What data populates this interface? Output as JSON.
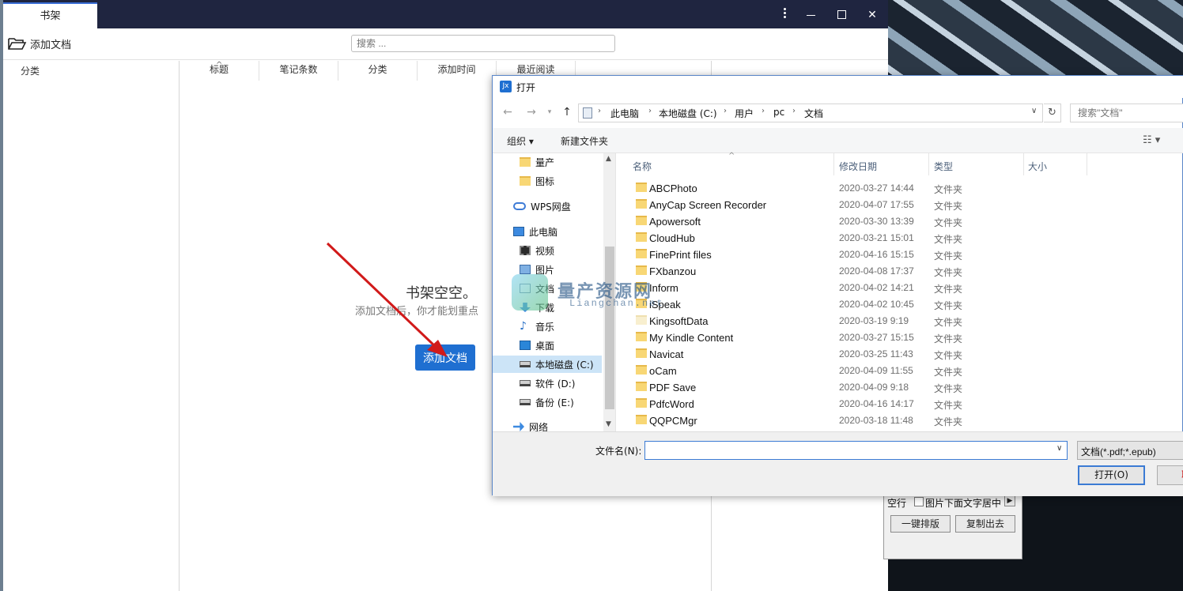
{
  "app": {
    "tab_label": "书架",
    "add_doc_label": "添加文档",
    "search_placeholder": "搜索 ...",
    "sidebar_header": "分类",
    "columns": [
      "标题",
      "笔记条数",
      "分类",
      "添加时间",
      "最近阅读"
    ],
    "empty_title": "书架空空。",
    "empty_subtitle": "添加文档后，你才能划重点",
    "empty_button": "添加文档"
  },
  "bg_window": {
    "left_label": "空行",
    "checkbox_label": "图片下面文字居中",
    "button_format": "一键排版",
    "button_copy": "复制出去"
  },
  "dialog": {
    "title": "打开",
    "title_icon": "Jx",
    "breadcrumbs": [
      "此电脑",
      "本地磁盘 (C:)",
      "用户",
      "pc",
      "文档"
    ],
    "search_placeholder": "搜索\"文档\"",
    "commands": {
      "organize": "组织 ▾",
      "new_folder": "新建文件夹"
    },
    "nav_items": [
      {
        "label": "量产",
        "icon": "folder-icon"
      },
      {
        "label": "图标",
        "icon": "folder-icon"
      },
      {
        "label": "WPS网盘",
        "icon": "cloud-icon"
      },
      {
        "label": "此电脑",
        "icon": "pc-icon"
      },
      {
        "label": "视频",
        "icon": "video-icon"
      },
      {
        "label": "图片",
        "icon": "picture-icon"
      },
      {
        "label": "文档",
        "icon": "document-icon"
      },
      {
        "label": "下载",
        "icon": "download-icon"
      },
      {
        "label": "音乐",
        "icon": "music-icon"
      },
      {
        "label": "桌面",
        "icon": "desktop-icon"
      },
      {
        "label": "本地磁盘 (C:)",
        "icon": "drive-icon",
        "selected": true
      },
      {
        "label": "软件 (D:)",
        "icon": "drive-icon"
      },
      {
        "label": "备份 (E:)",
        "icon": "drive-icon"
      },
      {
        "label": "网络",
        "icon": "network-icon"
      }
    ],
    "file_columns": [
      "名称",
      "修改日期",
      "类型",
      "大小"
    ],
    "files": [
      {
        "name": "ABCPhoto",
        "date": "2020-03-27 14:44",
        "type": "文件夹"
      },
      {
        "name": "AnyCap Screen Recorder",
        "date": "2020-04-07 17:55",
        "type": "文件夹"
      },
      {
        "name": "Apowersoft",
        "date": "2020-03-30 13:39",
        "type": "文件夹"
      },
      {
        "name": "CloudHub",
        "date": "2020-03-21 15:01",
        "type": "文件夹"
      },
      {
        "name": "FinePrint files",
        "date": "2020-04-16 15:15",
        "type": "文件夹"
      },
      {
        "name": "FXbanzou",
        "date": "2020-04-08 17:37",
        "type": "文件夹"
      },
      {
        "name": "Inform",
        "date": "2020-04-02 14:21",
        "type": "文件夹"
      },
      {
        "name": "iSpeak",
        "date": "2020-04-02 10:45",
        "type": "文件夹"
      },
      {
        "name": "KingsoftData",
        "date": "2020-03-19 9:19",
        "type": "文件夹",
        "pale": true
      },
      {
        "name": "My Kindle Content",
        "date": "2020-03-27 15:15",
        "type": "文件夹"
      },
      {
        "name": "Navicat",
        "date": "2020-03-25 11:43",
        "type": "文件夹"
      },
      {
        "name": "oCam",
        "date": "2020-04-09 11:55",
        "type": "文件夹"
      },
      {
        "name": "PDF Save",
        "date": "2020-04-09 9:18",
        "type": "文件夹"
      },
      {
        "name": "PdfcWord",
        "date": "2020-04-16 14:17",
        "type": "文件夹"
      },
      {
        "name": "QQPCMgr",
        "date": "2020-03-18 11:48",
        "type": "文件夹"
      }
    ],
    "filename_label": "文件名(N):",
    "filename_value": "",
    "filetype_value": "文档(*.pdf;*.epub)",
    "open_button": "打开(O)",
    "cancel_button": "取消"
  },
  "watermark": {
    "title": "量产资源网",
    "subtitle": "Liangchan.net"
  },
  "colors": {
    "titlebar": "#1f2540",
    "primary_button": "#1f6fd1",
    "annotation_arrow": "#d11a1a",
    "selection": "#cce4f7"
  }
}
